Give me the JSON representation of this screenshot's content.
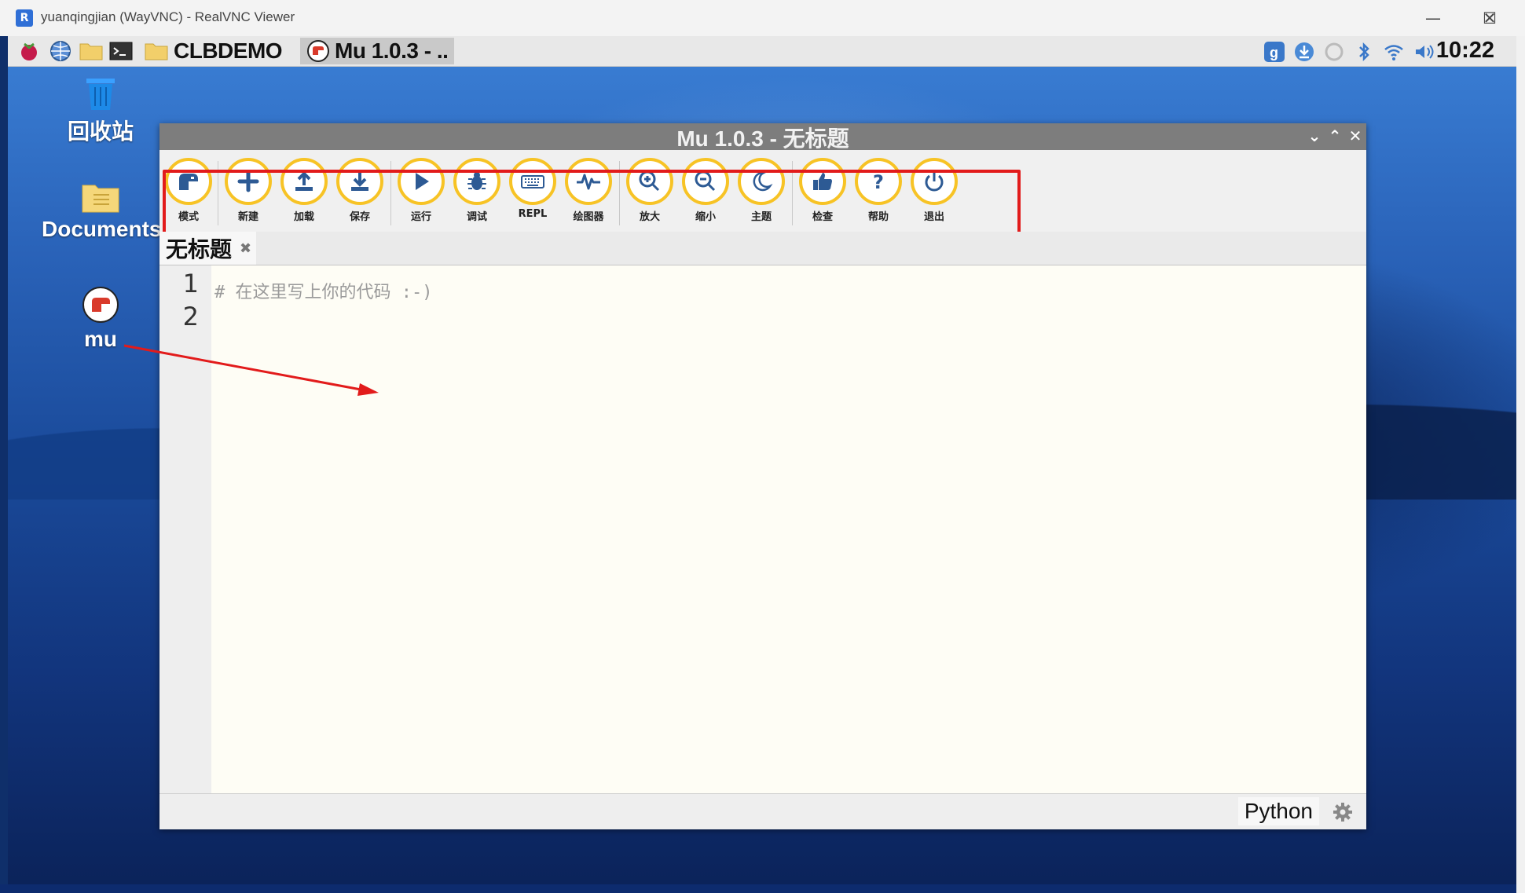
{
  "vnc_window": {
    "title": "yuanqingjian (WayVNC) - RealVNC Viewer",
    "minimize": "—",
    "maximize": "☐",
    "close": "✕"
  },
  "taskbar": {
    "folder_label": "CLBDEMO",
    "active_window": "Mu 1.0.3 - ..",
    "clock": "10:22"
  },
  "desktop_icons": [
    {
      "label": "回收站",
      "icon": "trash-icon"
    },
    {
      "label": "Documents",
      "icon": "folder-icon"
    },
    {
      "label": "mu",
      "icon": "mu-icon"
    }
  ],
  "mu": {
    "title": "Mu 1.0.3 - 无标题",
    "tools": [
      {
        "label": "模式",
        "icon": "mode-icon"
      },
      {
        "label": "新建",
        "icon": "new-icon"
      },
      {
        "label": "加载",
        "icon": "load-icon"
      },
      {
        "label": "保存",
        "icon": "save-icon"
      },
      {
        "label": "运行",
        "icon": "run-icon"
      },
      {
        "label": "调试",
        "icon": "debug-icon"
      },
      {
        "label": "REPL",
        "icon": "repl-icon"
      },
      {
        "label": "绘图器",
        "icon": "plotter-icon"
      },
      {
        "label": "放大",
        "icon": "zoom-in-icon"
      },
      {
        "label": "缩小",
        "icon": "zoom-out-icon"
      },
      {
        "label": "主题",
        "icon": "theme-icon"
      },
      {
        "label": "检查",
        "icon": "check-icon"
      },
      {
        "label": "帮助",
        "icon": "help-icon"
      },
      {
        "label": "退出",
        "icon": "quit-icon"
      }
    ],
    "tab": {
      "label": "无标题",
      "close": "✖"
    },
    "line_numbers": [
      "1",
      "2"
    ],
    "code": "# 在这里写上你的代码 :-)",
    "mode": "Python"
  },
  "colors": {
    "tool_ring": "#f7c325",
    "tool_icon": "#2d5a94",
    "highlight": "#e21b1b"
  }
}
